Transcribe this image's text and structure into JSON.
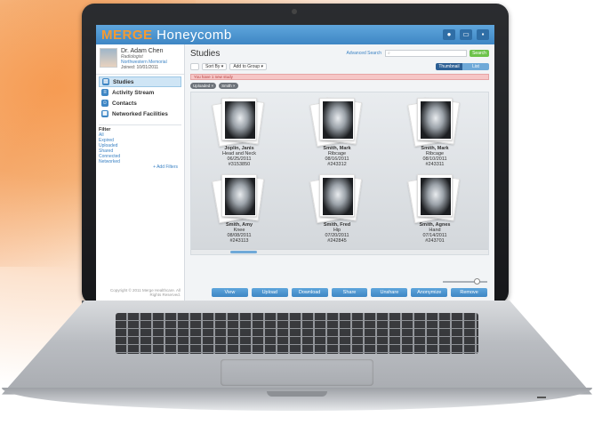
{
  "app": {
    "logo_part1": "MERGE",
    "logo_part2": " Honeycomb"
  },
  "profile": {
    "name": "Dr. Adam Chen",
    "role": "Radiologist",
    "organization": "Northwestern Memorial",
    "joined": "Joined: 10/01/2011"
  },
  "nav": [
    {
      "label": "Studies",
      "icon": "studies-icon",
      "active": true
    },
    {
      "label": "Activity Stream",
      "icon": "activity-icon",
      "active": false
    },
    {
      "label": "Contacts",
      "icon": "contacts-icon",
      "active": false
    },
    {
      "label": "Networked Facilities",
      "icon": "facilities-icon",
      "active": false
    }
  ],
  "filter": {
    "title": "Filter",
    "items": [
      "All",
      "Expired",
      "Uploaded",
      "Shared",
      "Connected",
      "Networked"
    ],
    "add_label": "+ Add Filters"
  },
  "copyright": "Copyright © 2011 Merge Healthcare. All Rights Reserved.",
  "header": {
    "title": "Studies",
    "advanced_search": "Advanced Search",
    "search_placeholder": "",
    "search_button": "Search"
  },
  "toolbar": {
    "sort_label": "Sort By",
    "group_label": "Add to Group",
    "view_thumbnail": "Thumbnail",
    "view_list": "List"
  },
  "banner": "You have 1 new study",
  "tags": [
    "Uploaded ×",
    "Smith ×"
  ],
  "studies": [
    {
      "name": "Joplin, Janis",
      "part": "Head and Neck",
      "date": "06/25/2011",
      "id": "#3153850"
    },
    {
      "name": "Smith, Mark",
      "part": "Ribcage",
      "date": "08/16/2011",
      "id": "#243312"
    },
    {
      "name": "Smith, Mark",
      "part": "Ribcage",
      "date": "08/10/2011",
      "id": "#243311"
    },
    {
      "name": "Smith, Amy",
      "part": "Knee",
      "date": "08/08/2011",
      "id": "#243113"
    },
    {
      "name": "Smith, Fred",
      "part": "Hip",
      "date": "07/20/2011",
      "id": "#242845"
    },
    {
      "name": "Smith, Agnes",
      "part": "Hand",
      "date": "07/14/2011",
      "id": "#243701"
    }
  ],
  "actions": [
    "View",
    "Upload",
    "Download",
    "Share",
    "Unshare",
    "Anonymize",
    "Remove"
  ],
  "colors": {
    "brand_blue": "#3e86c4",
    "logo_orange": "#f39a33",
    "search_green": "#6cc24a",
    "banner_red": "#f6c6c6"
  }
}
